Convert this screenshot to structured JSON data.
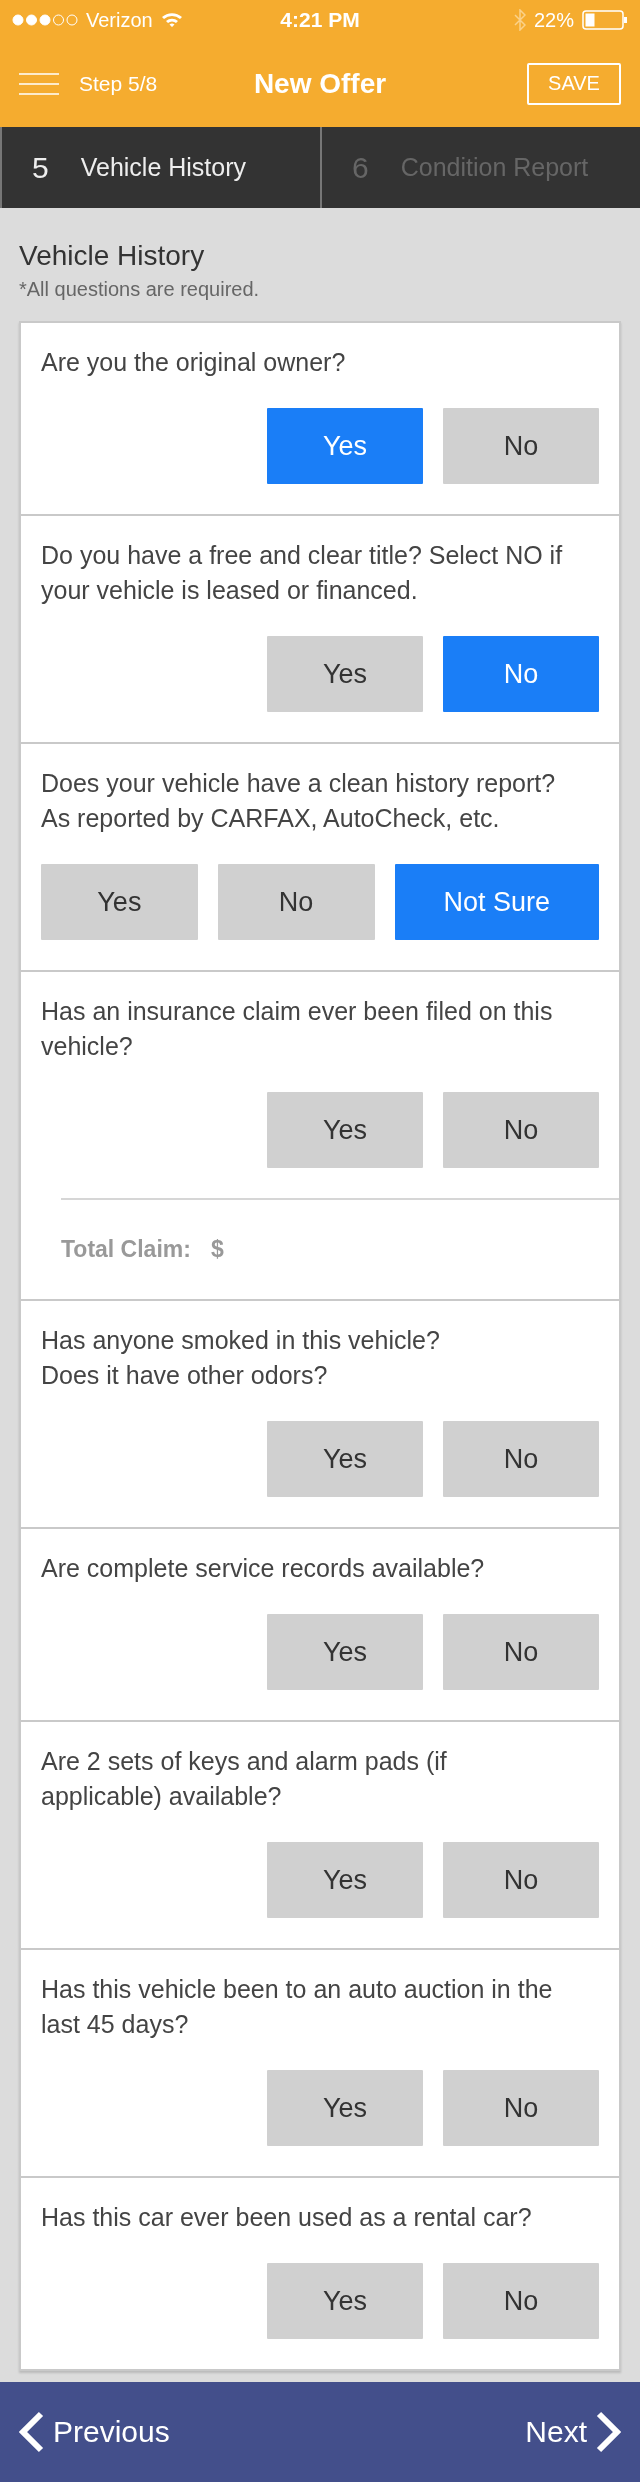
{
  "status_bar": {
    "carrier": "Verizon",
    "time": "4:21 PM",
    "battery": "22%"
  },
  "header": {
    "step": "Step 5/8",
    "title": "New Offer",
    "save": "SAVE"
  },
  "steps": [
    {
      "number": "5",
      "label": "Vehicle History",
      "selected": true
    },
    {
      "number": "6",
      "label": "Condition Report",
      "selected": false
    }
  ],
  "section": {
    "title": "Vehicle History",
    "note": "*All questions are required."
  },
  "questions": [
    {
      "text": "Are you the original owner?",
      "options": [
        {
          "label": "Yes",
          "selected": true
        },
        {
          "label": "No",
          "selected": false
        }
      ]
    },
    {
      "text": "Do you have a free and clear title? Select NO if your vehicle is leased or financed.",
      "options": [
        {
          "label": "Yes",
          "selected": false
        },
        {
          "label": "No",
          "selected": true
        }
      ]
    },
    {
      "text": "Does your vehicle have a clean history report? As reported by CARFAX, AutoCheck, etc.",
      "options": [
        {
          "label": "Yes",
          "selected": false
        },
        {
          "label": "No",
          "selected": false
        },
        {
          "label": "Not Sure",
          "selected": true
        }
      ]
    },
    {
      "text": "Has an insurance claim ever been filed on this vehicle?",
      "options": [
        {
          "label": "Yes",
          "selected": false
        },
        {
          "label": "No",
          "selected": false
        }
      ],
      "claim": {
        "label": "Total Claim:",
        "prefix": "$"
      }
    },
    {
      "text": "Has anyone smoked in this vehicle?\nDoes it have other odors?",
      "options": [
        {
          "label": "Yes",
          "selected": false
        },
        {
          "label": "No",
          "selected": false
        }
      ]
    },
    {
      "text": "Are complete service records available?",
      "options": [
        {
          "label": "Yes",
          "selected": false
        },
        {
          "label": "No",
          "selected": false
        }
      ]
    },
    {
      "text": "Are 2 sets of keys and alarm pads (if applicable) available?",
      "options": [
        {
          "label": "Yes",
          "selected": false
        },
        {
          "label": "No",
          "selected": false
        }
      ]
    },
    {
      "text": "Has this vehicle been to an auto auction in the last 45 days?",
      "options": [
        {
          "label": "Yes",
          "selected": false
        },
        {
          "label": "No",
          "selected": false
        }
      ]
    },
    {
      "text": "Has this car ever been used as a rental car?",
      "options": [
        {
          "label": "Yes",
          "selected": false
        },
        {
          "label": "No",
          "selected": false
        }
      ]
    }
  ],
  "footer": {
    "previous": "Previous",
    "next": "Next"
  }
}
